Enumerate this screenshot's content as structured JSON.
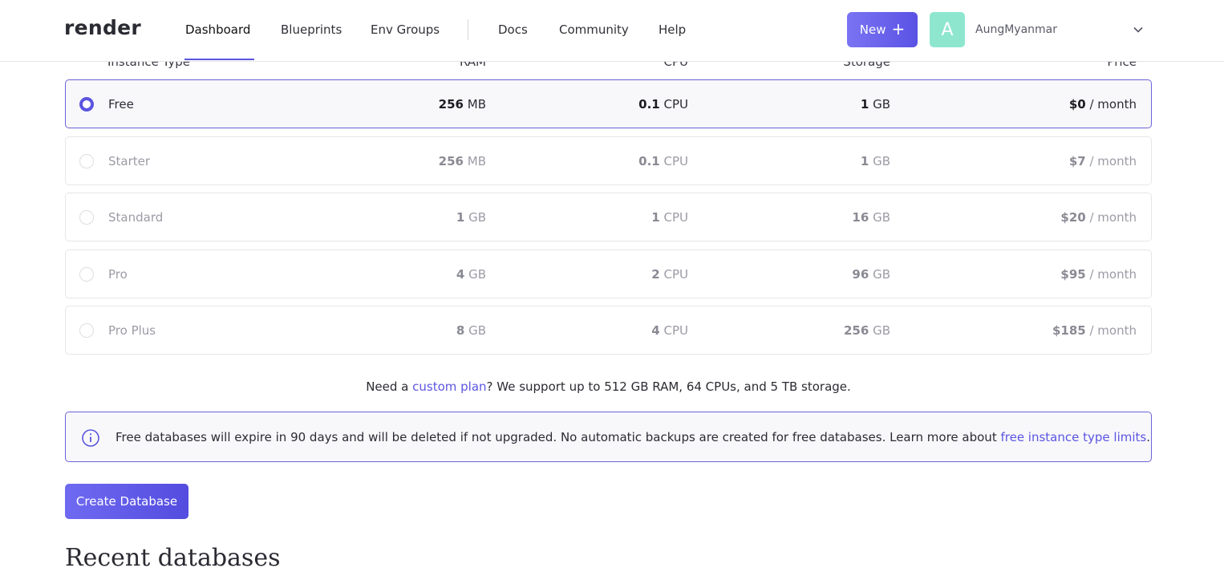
{
  "header": {
    "logo": "render",
    "nav": [
      "Dashboard",
      "Blueprints",
      "Env Groups",
      "Docs",
      "Community",
      "Help"
    ],
    "new_button": "New",
    "new_icon": "plus-icon",
    "avatar_letter": "A",
    "username": "AungMyanmar",
    "dropdown_icon": "chevron-down-icon"
  },
  "table": {
    "headers": [
      "Instance Type",
      "RAM",
      "CPU",
      "Storage",
      "Price"
    ],
    "rows": [
      {
        "name": "Free",
        "ram_v": "256",
        "ram_u": "MB",
        "cpu_v": "0.1",
        "cpu_u": "CPU",
        "st_v": "1",
        "st_u": "GB",
        "price_v": "$0",
        "price_u": "/ month",
        "selected": true
      },
      {
        "name": "Starter",
        "ram_v": "256",
        "ram_u": "MB",
        "cpu_v": "0.1",
        "cpu_u": "CPU",
        "st_v": "1",
        "st_u": "GB",
        "price_v": "$7",
        "price_u": "/ month",
        "selected": false
      },
      {
        "name": "Standard",
        "ram_v": "1",
        "ram_u": "GB",
        "cpu_v": "1",
        "cpu_u": "CPU",
        "st_v": "16",
        "st_u": "GB",
        "price_v": "$20",
        "price_u": "/ month",
        "selected": false
      },
      {
        "name": "Pro",
        "ram_v": "4",
        "ram_u": "GB",
        "cpu_v": "2",
        "cpu_u": "CPU",
        "st_v": "96",
        "st_u": "GB",
        "price_v": "$95",
        "price_u": "/ month",
        "selected": false
      },
      {
        "name": "Pro Plus",
        "ram_v": "8",
        "ram_u": "GB",
        "cpu_v": "4",
        "cpu_u": "CPU",
        "st_v": "256",
        "st_u": "GB",
        "price_v": "$185",
        "price_u": "/ month",
        "selected": false
      }
    ]
  },
  "custom": {
    "before": "Need a ",
    "link": "custom plan",
    "after": "? We support up to 512 GB RAM, 64 CPUs, and 5 TB storage."
  },
  "info": {
    "icon": "info-icon",
    "text": "Free databases will expire in 90 days and will be deleted if not upgraded. No automatic backups are created for free databases. Learn more about ",
    "link": "free instance type limits",
    "end": "."
  },
  "create_button": "Create Database",
  "next_heading": "Recent databases"
}
